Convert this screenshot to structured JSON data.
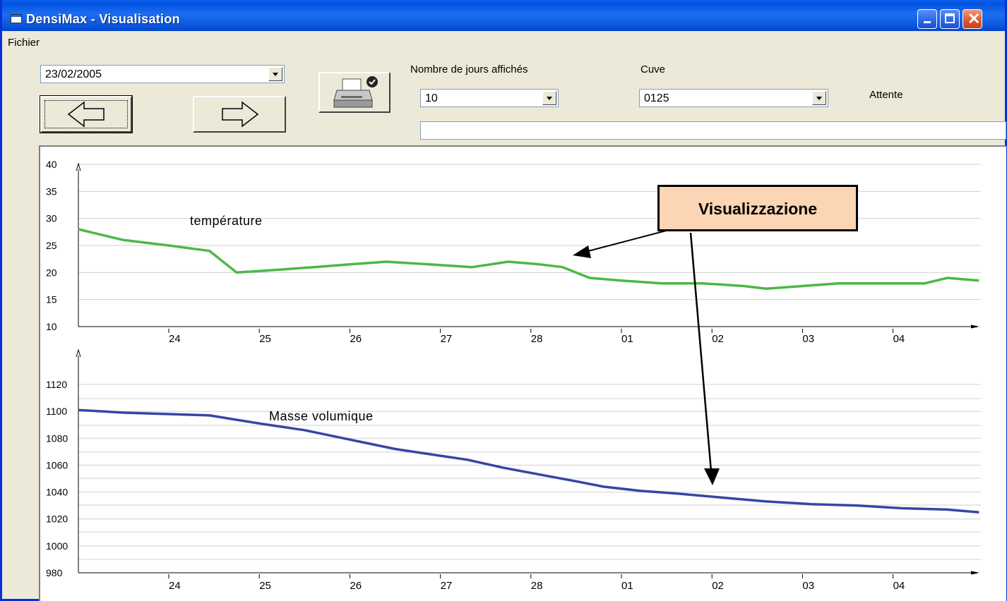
{
  "window": {
    "title": "DensiMax - Visualisation"
  },
  "menu": {
    "items": [
      "Fichier"
    ]
  },
  "controls": {
    "date_value": "23/02/2005",
    "days_label": "Nombre de jours affichés",
    "days_value": "10",
    "cuve_label": "Cuve",
    "cuve_value": "0125",
    "status": "Attente",
    "message": ""
  },
  "icons": {
    "prev": "arrow-left-icon",
    "next": "arrow-right-icon",
    "print": "printer-icon"
  },
  "colors": {
    "temperature_line": "#4CB848",
    "density_line": "#3547A3",
    "annotation_bg": "#FCD5B4"
  },
  "annotation": {
    "label": "Visualizzazione"
  },
  "chart_data": [
    {
      "type": "line",
      "title": "température",
      "x": [
        "24",
        "25",
        "26",
        "27",
        "28",
        "01",
        "02",
        "03",
        "04"
      ],
      "ylim": [
        10,
        40
      ],
      "yticks": [
        10,
        15,
        20,
        25,
        30,
        35,
        40
      ],
      "grid": true,
      "series": [
        {
          "name": "température",
          "points": [
            [
              23.0,
              28
            ],
            [
              23.5,
              26
            ],
            [
              24.0,
              25
            ],
            [
              24.45,
              24
            ],
            [
              24.75,
              20
            ],
            [
              25.2,
              20.5
            ],
            [
              25.6,
              21
            ],
            [
              26.0,
              21.5
            ],
            [
              26.4,
              22
            ],
            [
              26.8,
              21.6
            ],
            [
              27.35,
              21
            ],
            [
              27.75,
              22
            ],
            [
              28.1,
              21.5
            ],
            [
              28.35,
              21
            ],
            [
              28.65,
              19
            ],
            [
              29.0,
              18.5
            ],
            [
              29.45,
              18
            ],
            [
              29.9,
              18
            ],
            [
              30.35,
              17.5
            ],
            [
              30.6,
              17
            ],
            [
              31.0,
              17.5
            ],
            [
              31.4,
              18
            ],
            [
              32.0,
              18
            ],
            [
              32.35,
              18
            ],
            [
              32.6,
              19
            ],
            [
              32.95,
              18.5
            ]
          ]
        }
      ]
    },
    {
      "type": "line",
      "title": "Masse volumique",
      "x": [
        "24",
        "25",
        "26",
        "27",
        "28",
        "01",
        "02",
        "03",
        "04"
      ],
      "ylim": [
        980,
        1140
      ],
      "yticks": [
        980,
        1000,
        1020,
        1040,
        1060,
        1080,
        1100,
        1120
      ],
      "grid": true,
      "series": [
        {
          "name": "Masse volumique",
          "points": [
            [
              23.0,
              1101
            ],
            [
              23.5,
              1099
            ],
            [
              24.0,
              1098
            ],
            [
              24.45,
              1097
            ],
            [
              25.0,
              1091
            ],
            [
              25.5,
              1086
            ],
            [
              26.0,
              1079
            ],
            [
              26.5,
              1072
            ],
            [
              27.0,
              1067
            ],
            [
              27.3,
              1064
            ],
            [
              27.7,
              1058
            ],
            [
              28.1,
              1053
            ],
            [
              28.5,
              1048
            ],
            [
              28.8,
              1044
            ],
            [
              29.2,
              1041
            ],
            [
              29.6,
              1039
            ],
            [
              30.1,
              1036
            ],
            [
              30.6,
              1033
            ],
            [
              31.1,
              1031
            ],
            [
              31.6,
              1030
            ],
            [
              32.1,
              1028
            ],
            [
              32.6,
              1027
            ],
            [
              32.95,
              1025
            ]
          ]
        }
      ]
    }
  ]
}
